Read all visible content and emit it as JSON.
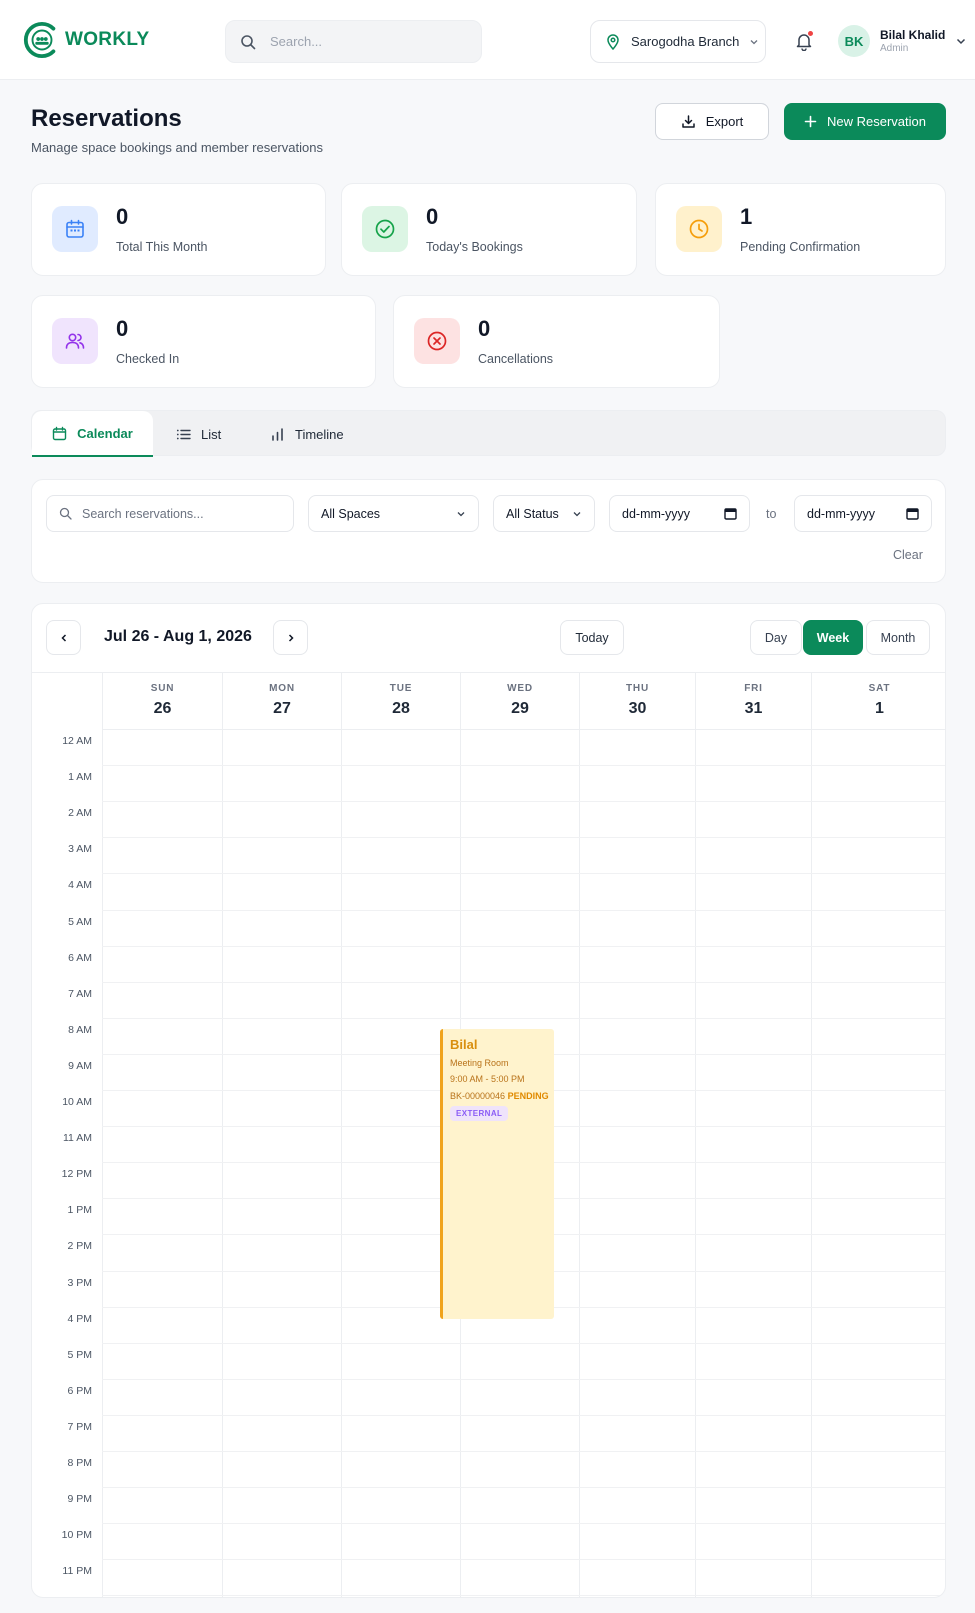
{
  "brand": {
    "name": "WORKLY",
    "color": "#0b8a5a"
  },
  "header": {
    "search_placeholder": "Search...",
    "branch": "Sarogodha Branch",
    "user": {
      "initials": "BK",
      "name": "Bilal Khalid",
      "role": "Admin"
    }
  },
  "page": {
    "title": "Reservations",
    "subtitle": "Manage space bookings and member reservations",
    "export_label": "Export",
    "new_label": "New Reservation"
  },
  "stats": [
    {
      "value": "0",
      "label": "Total This Month",
      "icon": "calendar-icon",
      "color": "#3b82f6"
    },
    {
      "value": "0",
      "label": "Today's Bookings",
      "icon": "check-circle-icon",
      "color": "#16a34a"
    },
    {
      "value": "1",
      "label": "Pending Confirmation",
      "icon": "clock-icon",
      "color": "#f59e0b"
    },
    {
      "value": "0",
      "label": "Checked In",
      "icon": "users-icon",
      "color": "#9333ea"
    },
    {
      "value": "0",
      "label": "Cancellations",
      "icon": "x-circle-icon",
      "color": "#dc2626"
    }
  ],
  "tabs": [
    {
      "label": "Calendar",
      "active": true
    },
    {
      "label": "List",
      "active": false
    },
    {
      "label": "Timeline",
      "active": false
    }
  ],
  "filters": {
    "search_placeholder": "Search reservations...",
    "spaces": "All Spaces",
    "status": "All Status",
    "date_from": "dd-mm-yyyy",
    "to": "to",
    "date_to": "dd-mm-yyyy",
    "clear": "Clear"
  },
  "calendar": {
    "range": "Jul 26 - Aug 1, 2026",
    "today": "Today",
    "views": [
      {
        "label": "Day",
        "active": false
      },
      {
        "label": "Week",
        "active": true
      },
      {
        "label": "Month",
        "active": false
      }
    ],
    "days": [
      {
        "dow": "SUN",
        "date": "26"
      },
      {
        "dow": "MON",
        "date": "27"
      },
      {
        "dow": "TUE",
        "date": "28"
      },
      {
        "dow": "WED",
        "date": "29"
      },
      {
        "dow": "THU",
        "date": "30"
      },
      {
        "dow": "FRI",
        "date": "31"
      },
      {
        "dow": "SAT",
        "date": "1"
      }
    ],
    "hours": [
      "12 AM",
      "1 AM",
      "2 AM",
      "3 AM",
      "4 AM",
      "5 AM",
      "6 AM",
      "7 AM",
      "8 AM",
      "9 AM",
      "10 AM",
      "11 AM",
      "12 PM",
      "1 PM",
      "2 PM",
      "3 PM",
      "4 PM",
      "5 PM",
      "6 PM",
      "7 PM",
      "8 PM",
      "9 PM",
      "10 PM",
      "11 PM"
    ],
    "event": {
      "title": "Bilal",
      "room": "Meeting Room",
      "time": "9:00 AM - 5:00 PM",
      "code": "BK-00000046",
      "status": "PENDING",
      "tag": "EXTERNAL"
    }
  }
}
